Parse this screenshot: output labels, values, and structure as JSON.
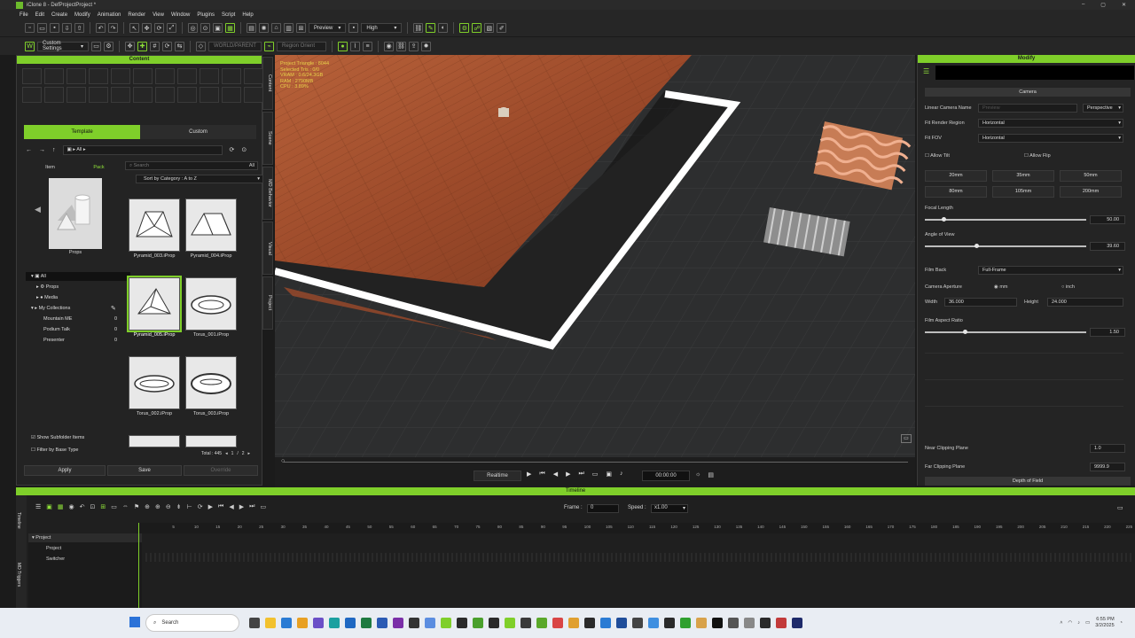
{
  "app": {
    "title": "iClone 8 - DefProjectProject *",
    "accent": "#7fcf2a"
  },
  "menu": [
    "File",
    "Edit",
    "Create",
    "Modify",
    "Animation",
    "Render",
    "View",
    "Window",
    "Plugins",
    "Script",
    "Help"
  ],
  "toolbar": {
    "preview_label": "Preview",
    "quality_label": "High",
    "custom_settings": "Custom Settings",
    "gizmo_label": "WORLD/PARENT",
    "region_label": "Region Orient"
  },
  "content": {
    "title": "Content",
    "tabs": [
      "Template",
      "Custom"
    ],
    "breadcrumb": "All",
    "subtabs": [
      "Item",
      "Pack"
    ],
    "search_placeholder": "Search",
    "search_filter": "All",
    "sort_label": "Sort by Category : A to Z",
    "preview_label": "Props",
    "tree": [
      {
        "label": "All",
        "count": ""
      },
      {
        "label": "Props",
        "count": ""
      },
      {
        "label": "Media",
        "count": ""
      },
      {
        "label": "My Collections",
        "count": ""
      },
      {
        "label": "Mountain ME",
        "count": "0"
      },
      {
        "label": "Podium Talk",
        "count": "0"
      },
      {
        "label": "Presenter",
        "count": "0"
      }
    ],
    "items": [
      {
        "label": "Pyramid_003.iProp"
      },
      {
        "label": "Pyramid_004.iProp"
      },
      {
        "label": "Pyramid_005.iProp"
      },
      {
        "label": "Torus_001.iProp"
      },
      {
        "label": "Torus_002.iProp"
      },
      {
        "label": "Torus_003.iProp"
      }
    ],
    "show_subfolder": "Show Subfolder Items",
    "filter_base": "Filter by Base Type",
    "total": "Total : 445",
    "page": "1",
    "pages": "2",
    "apply": "Apply",
    "save": "Save",
    "override": "Override"
  },
  "side_tabs": [
    "Content",
    "Scene",
    "MD Behavior",
    "Visual",
    "Project"
  ],
  "stats": [
    "Project Triangle : 8044",
    "Selected Tris : 0/0",
    "VRAM : 0.6/24.3GB",
    "RAM : 2790MB",
    "CPU : 3.89%"
  ],
  "playback": {
    "mode": "Realtime",
    "time": "00:00:00"
  },
  "modify": {
    "title": "Modify",
    "section_camera": "Camera",
    "linear_camera_name": "Linear Camera Name",
    "camera_name_placeholder": "Preview",
    "projection": "Perspective",
    "fit_render_region": "Fit Render Region",
    "fit_render_value": "Horizontal",
    "fit_fov": "Fit FOV",
    "fit_fov_value": "Horizontal",
    "allow_tilt": "Allow Tilt",
    "allow_flip": "Allow Flip",
    "lenses": [
      "20mm",
      "35mm",
      "50mm",
      "80mm",
      "105mm",
      "200mm"
    ],
    "focal_length": "Focal Length",
    "focal_value": "50.00",
    "angle_of_view": "Angle of View",
    "angle_value": "39.60",
    "film_back": "Film Back",
    "film_back_value": "Full-Frame",
    "camera_aperture": "Camera Aperture",
    "unit_mm": "mm",
    "unit_inch": "inch",
    "width_label": "Width",
    "width_value": "36.000",
    "height_label": "Height",
    "height_value": "24.000",
    "film_aspect": "Film Aspect Ratio",
    "film_aspect_value": "1.50",
    "near_clip": "Near Clipping Plane",
    "near_value": "1.0",
    "far_clip": "Far Clipping Plane",
    "far_value": "9999.9",
    "section_dof": "Depth of Field",
    "focal_level": 0.12,
    "angle_level": 0.32,
    "aspect_level": 0.25
  },
  "timeline": {
    "title": "Timeline",
    "frame_label": "Frame :",
    "frame_value": "0",
    "speed_label": "Speed :",
    "speed_value": "x1.00",
    "side_tabs": [
      "Timeline",
      "MD Triggers"
    ],
    "tracks": [
      "Project",
      "Project",
      "Switcher"
    ],
    "ruler": [
      "5",
      "10",
      "15",
      "20",
      "25",
      "30",
      "35",
      "40",
      "45",
      "50",
      "55",
      "60",
      "65",
      "70",
      "75",
      "80",
      "85",
      "90",
      "95",
      "100",
      "105",
      "110",
      "115",
      "120",
      "125",
      "130",
      "135",
      "140",
      "145",
      "150",
      "155",
      "160",
      "165",
      "170",
      "175",
      "180",
      "185",
      "190",
      "195",
      "200",
      "205",
      "210",
      "215",
      "220",
      "225"
    ]
  },
  "taskbar": {
    "search_placeholder": "Search",
    "time": "6:55 PM",
    "date": "3/2/2025"
  }
}
